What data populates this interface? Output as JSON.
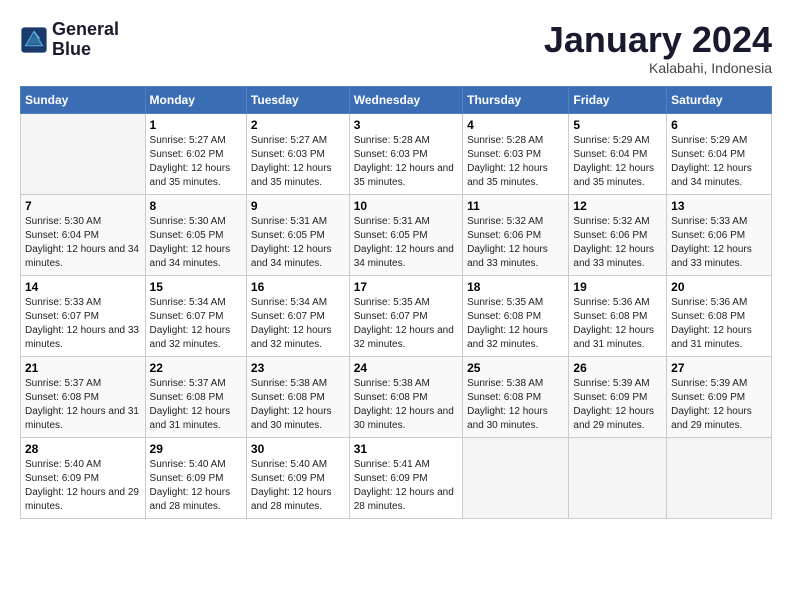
{
  "header": {
    "logo": {
      "line1": "General",
      "line2": "Blue"
    },
    "title": "January 2024",
    "subtitle": "Kalabahi, Indonesia"
  },
  "days_of_week": [
    "Sunday",
    "Monday",
    "Tuesday",
    "Wednesday",
    "Thursday",
    "Friday",
    "Saturday"
  ],
  "weeks": [
    [
      {
        "day": "",
        "sunrise": "",
        "sunset": "",
        "daylight": ""
      },
      {
        "day": "1",
        "sunrise": "Sunrise: 5:27 AM",
        "sunset": "Sunset: 6:02 PM",
        "daylight": "Daylight: 12 hours and 35 minutes."
      },
      {
        "day": "2",
        "sunrise": "Sunrise: 5:27 AM",
        "sunset": "Sunset: 6:03 PM",
        "daylight": "Daylight: 12 hours and 35 minutes."
      },
      {
        "day": "3",
        "sunrise": "Sunrise: 5:28 AM",
        "sunset": "Sunset: 6:03 PM",
        "daylight": "Daylight: 12 hours and 35 minutes."
      },
      {
        "day": "4",
        "sunrise": "Sunrise: 5:28 AM",
        "sunset": "Sunset: 6:03 PM",
        "daylight": "Daylight: 12 hours and 35 minutes."
      },
      {
        "day": "5",
        "sunrise": "Sunrise: 5:29 AM",
        "sunset": "Sunset: 6:04 PM",
        "daylight": "Daylight: 12 hours and 35 minutes."
      },
      {
        "day": "6",
        "sunrise": "Sunrise: 5:29 AM",
        "sunset": "Sunset: 6:04 PM",
        "daylight": "Daylight: 12 hours and 34 minutes."
      }
    ],
    [
      {
        "day": "7",
        "sunrise": "Sunrise: 5:30 AM",
        "sunset": "Sunset: 6:04 PM",
        "daylight": "Daylight: 12 hours and 34 minutes."
      },
      {
        "day": "8",
        "sunrise": "Sunrise: 5:30 AM",
        "sunset": "Sunset: 6:05 PM",
        "daylight": "Daylight: 12 hours and 34 minutes."
      },
      {
        "day": "9",
        "sunrise": "Sunrise: 5:31 AM",
        "sunset": "Sunset: 6:05 PM",
        "daylight": "Daylight: 12 hours and 34 minutes."
      },
      {
        "day": "10",
        "sunrise": "Sunrise: 5:31 AM",
        "sunset": "Sunset: 6:05 PM",
        "daylight": "Daylight: 12 hours and 34 minutes."
      },
      {
        "day": "11",
        "sunrise": "Sunrise: 5:32 AM",
        "sunset": "Sunset: 6:06 PM",
        "daylight": "Daylight: 12 hours and 33 minutes."
      },
      {
        "day": "12",
        "sunrise": "Sunrise: 5:32 AM",
        "sunset": "Sunset: 6:06 PM",
        "daylight": "Daylight: 12 hours and 33 minutes."
      },
      {
        "day": "13",
        "sunrise": "Sunrise: 5:33 AM",
        "sunset": "Sunset: 6:06 PM",
        "daylight": "Daylight: 12 hours and 33 minutes."
      }
    ],
    [
      {
        "day": "14",
        "sunrise": "Sunrise: 5:33 AM",
        "sunset": "Sunset: 6:07 PM",
        "daylight": "Daylight: 12 hours and 33 minutes."
      },
      {
        "day": "15",
        "sunrise": "Sunrise: 5:34 AM",
        "sunset": "Sunset: 6:07 PM",
        "daylight": "Daylight: 12 hours and 32 minutes."
      },
      {
        "day": "16",
        "sunrise": "Sunrise: 5:34 AM",
        "sunset": "Sunset: 6:07 PM",
        "daylight": "Daylight: 12 hours and 32 minutes."
      },
      {
        "day": "17",
        "sunrise": "Sunrise: 5:35 AM",
        "sunset": "Sunset: 6:07 PM",
        "daylight": "Daylight: 12 hours and 32 minutes."
      },
      {
        "day": "18",
        "sunrise": "Sunrise: 5:35 AM",
        "sunset": "Sunset: 6:08 PM",
        "daylight": "Daylight: 12 hours and 32 minutes."
      },
      {
        "day": "19",
        "sunrise": "Sunrise: 5:36 AM",
        "sunset": "Sunset: 6:08 PM",
        "daylight": "Daylight: 12 hours and 31 minutes."
      },
      {
        "day": "20",
        "sunrise": "Sunrise: 5:36 AM",
        "sunset": "Sunset: 6:08 PM",
        "daylight": "Daylight: 12 hours and 31 minutes."
      }
    ],
    [
      {
        "day": "21",
        "sunrise": "Sunrise: 5:37 AM",
        "sunset": "Sunset: 6:08 PM",
        "daylight": "Daylight: 12 hours and 31 minutes."
      },
      {
        "day": "22",
        "sunrise": "Sunrise: 5:37 AM",
        "sunset": "Sunset: 6:08 PM",
        "daylight": "Daylight: 12 hours and 31 minutes."
      },
      {
        "day": "23",
        "sunrise": "Sunrise: 5:38 AM",
        "sunset": "Sunset: 6:08 PM",
        "daylight": "Daylight: 12 hours and 30 minutes."
      },
      {
        "day": "24",
        "sunrise": "Sunrise: 5:38 AM",
        "sunset": "Sunset: 6:08 PM",
        "daylight": "Daylight: 12 hours and 30 minutes."
      },
      {
        "day": "25",
        "sunrise": "Sunrise: 5:38 AM",
        "sunset": "Sunset: 6:08 PM",
        "daylight": "Daylight: 12 hours and 30 minutes."
      },
      {
        "day": "26",
        "sunrise": "Sunrise: 5:39 AM",
        "sunset": "Sunset: 6:09 PM",
        "daylight": "Daylight: 12 hours and 29 minutes."
      },
      {
        "day": "27",
        "sunrise": "Sunrise: 5:39 AM",
        "sunset": "Sunset: 6:09 PM",
        "daylight": "Daylight: 12 hours and 29 minutes."
      }
    ],
    [
      {
        "day": "28",
        "sunrise": "Sunrise: 5:40 AM",
        "sunset": "Sunset: 6:09 PM",
        "daylight": "Daylight: 12 hours and 29 minutes."
      },
      {
        "day": "29",
        "sunrise": "Sunrise: 5:40 AM",
        "sunset": "Sunset: 6:09 PM",
        "daylight": "Daylight: 12 hours and 28 minutes."
      },
      {
        "day": "30",
        "sunrise": "Sunrise: 5:40 AM",
        "sunset": "Sunset: 6:09 PM",
        "daylight": "Daylight: 12 hours and 28 minutes."
      },
      {
        "day": "31",
        "sunrise": "Sunrise: 5:41 AM",
        "sunset": "Sunset: 6:09 PM",
        "daylight": "Daylight: 12 hours and 28 minutes."
      },
      {
        "day": "",
        "sunrise": "",
        "sunset": "",
        "daylight": ""
      },
      {
        "day": "",
        "sunrise": "",
        "sunset": "",
        "daylight": ""
      },
      {
        "day": "",
        "sunrise": "",
        "sunset": "",
        "daylight": ""
      }
    ]
  ]
}
